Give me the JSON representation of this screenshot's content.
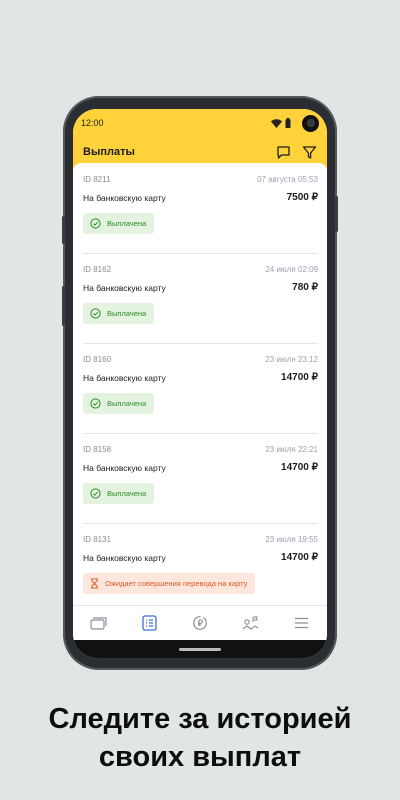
{
  "status_bar": {
    "time": "12:00"
  },
  "header": {
    "title": "Выплаты",
    "chat_icon": "chat-icon",
    "filter_icon": "filter-icon"
  },
  "payouts": [
    {
      "id": "ID 8211",
      "date": "07 августа 05:53",
      "method": "На банковскую карту",
      "amount": "7500 ₽",
      "status": "Выплачена",
      "status_type": "paid"
    },
    {
      "id": "ID 8162",
      "date": "24 июля 02:09",
      "method": "На банковскую карту",
      "amount": "780 ₽",
      "status": "Выплачена",
      "status_type": "paid"
    },
    {
      "id": "ID 8160",
      "date": "23 июля 23:12",
      "method": "На банковскую карту",
      "amount": "14700 ₽",
      "status": "Выплачена",
      "status_type": "paid"
    },
    {
      "id": "ID 8158",
      "date": "23 июля 22:21",
      "method": "На банковскую карту",
      "amount": "14700 ₽",
      "status": "Выплачена",
      "status_type": "paid"
    },
    {
      "id": "ID 8131",
      "date": "23 июля 19:55",
      "method": "На банковскую карту",
      "amount": "14700 ₽",
      "status": "Ожидает совершения перевода на карту",
      "status_type": "waiting"
    }
  ],
  "tabs": [
    {
      "icon": "card-icon",
      "active": false
    },
    {
      "icon": "list-icon",
      "active": true
    },
    {
      "icon": "exchange-icon",
      "active": false
    },
    {
      "icon": "map-icon",
      "active": false
    },
    {
      "icon": "menu-icon",
      "active": false
    }
  ],
  "caption": {
    "line1": "Следите за историей",
    "line2": "своих выплат"
  },
  "colors": {
    "header_bg": "#ffd23a",
    "paid_green": "#2c8d2a",
    "waiting_orange": "#e2582a",
    "active_tab": "#3b6fd6"
  }
}
